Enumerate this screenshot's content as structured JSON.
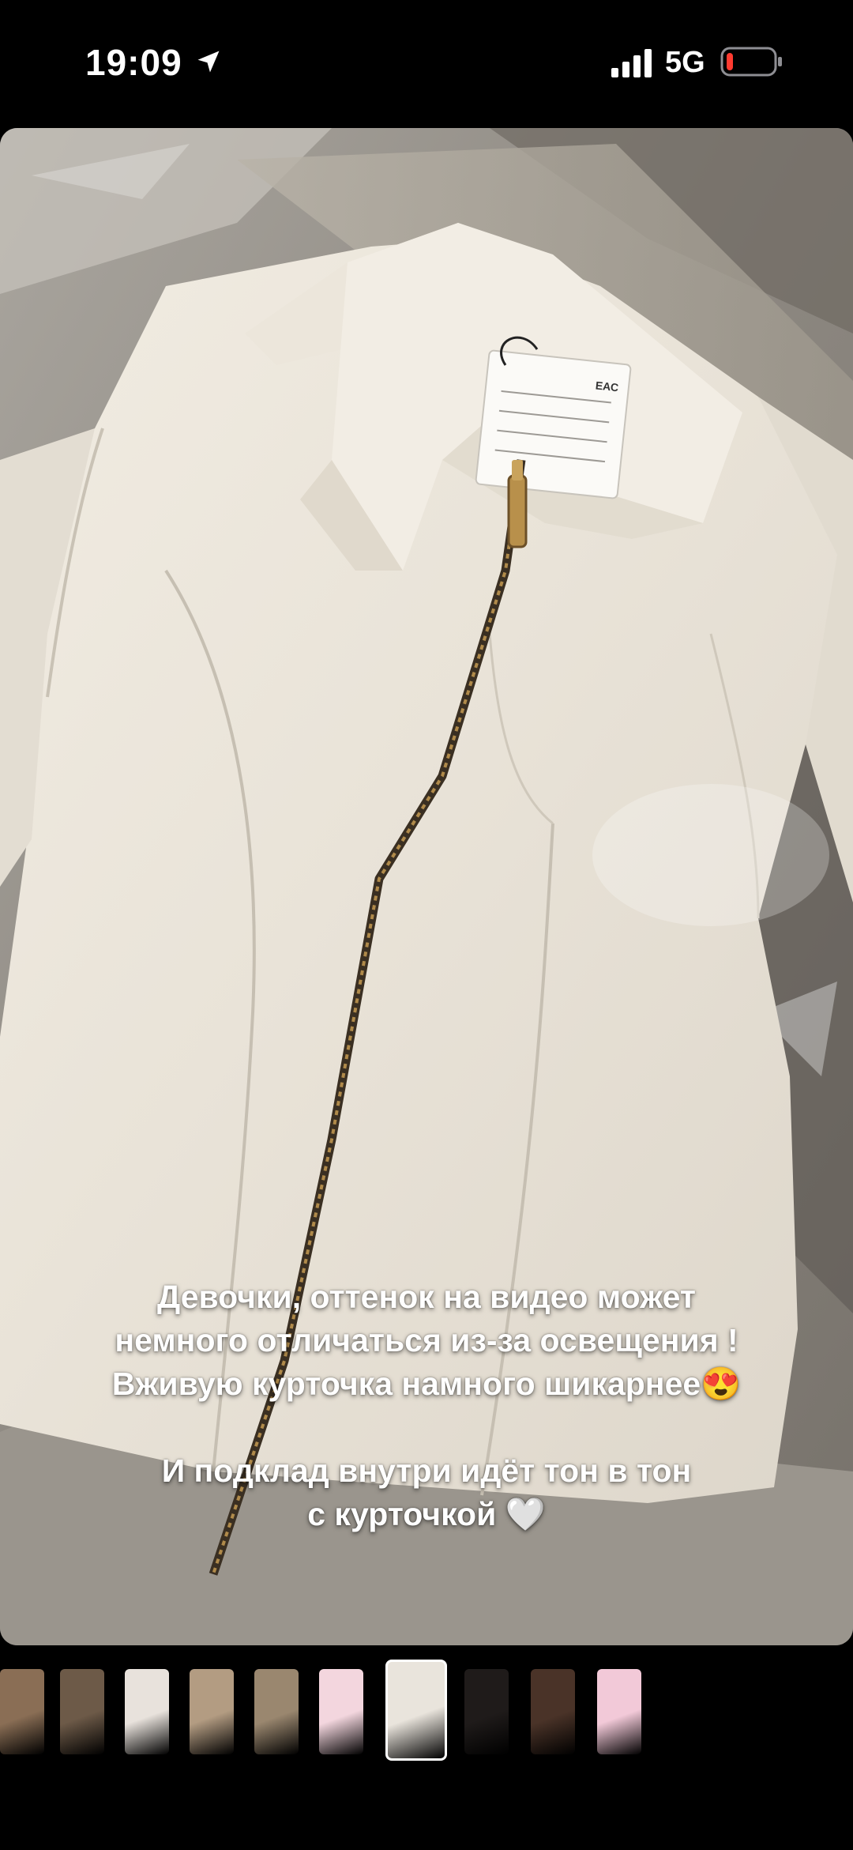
{
  "status_bar": {
    "time": "19:09",
    "network": "5G",
    "battery_color": "#ff3b30"
  },
  "story": {
    "caption_lines": [
      "Девочки, оттенок на видео может",
      "немного отличаться из-за освещения !",
      "Вживую курточка намного шикарнее😍",
      "",
      "И подклад внутри идёт тон в тон",
      "с курточкой 🤍"
    ],
    "tag_label": "ЕАС"
  },
  "thumbnails": {
    "count": 10,
    "active_index": 6,
    "colors": [
      "#8a6e55",
      "#6d5a48",
      "#e8e2dc",
      "#b39c82",
      "#9a876f",
      "#f3d6de",
      "#e9e4dc",
      "#1f1b1a",
      "#4a3328",
      "#f2c9d8"
    ]
  }
}
